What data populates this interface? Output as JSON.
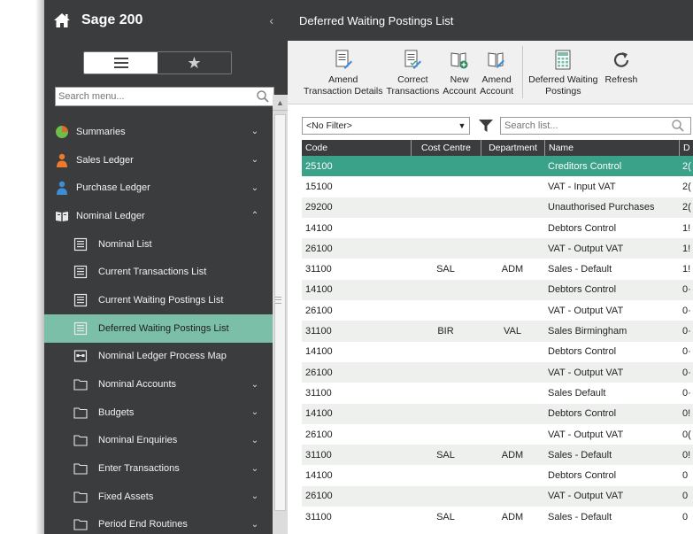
{
  "sidebar": {
    "title": "Sage 200",
    "collapse_glyph": "‹",
    "search_placeholder": "Search menu...",
    "items": [
      {
        "label": "Summaries",
        "icon": "pie-chart-icon",
        "level": 0,
        "chevron": "⌄"
      },
      {
        "label": "Sales Ledger",
        "icon": "sales-person-icon",
        "level": 0,
        "chevron": "⌄"
      },
      {
        "label": "Purchase Ledger",
        "icon": "purchase-person-icon",
        "level": 0,
        "chevron": "⌄"
      },
      {
        "label": "Nominal Ledger",
        "icon": "book-icon",
        "level": 0,
        "chevron": "⌃"
      },
      {
        "label": "Nominal List",
        "icon": "list-icon",
        "level": 1,
        "chevron": ""
      },
      {
        "label": "Current Transactions List",
        "icon": "list-icon",
        "level": 1,
        "chevron": ""
      },
      {
        "label": "Current Waiting Postings List",
        "icon": "list-icon",
        "level": 1,
        "chevron": ""
      },
      {
        "label": "Deferred Waiting Postings List",
        "icon": "list-icon",
        "level": 1,
        "chevron": "",
        "active": true
      },
      {
        "label": "Nominal Ledger Process Map",
        "icon": "process-map-icon",
        "level": 1,
        "chevron": ""
      },
      {
        "label": "Nominal Accounts",
        "icon": "folder-icon",
        "level": 1,
        "chevron": "⌄"
      },
      {
        "label": "Budgets",
        "icon": "folder-icon",
        "level": 1,
        "chevron": "⌄"
      },
      {
        "label": "Nominal Enquiries",
        "icon": "folder-icon",
        "level": 1,
        "chevron": "⌄"
      },
      {
        "label": "Enter Transactions",
        "icon": "folder-icon",
        "level": 1,
        "chevron": "⌄"
      },
      {
        "label": "Fixed Assets",
        "icon": "folder-icon",
        "level": 1,
        "chevron": "⌄"
      },
      {
        "label": "Period End Routines",
        "icon": "folder-icon",
        "level": 1,
        "chevron": "⌄"
      }
    ]
  },
  "main": {
    "title": "Deferred Waiting Postings List",
    "toolbar": [
      {
        "line1": "Amend",
        "line2": "Transaction Details",
        "icon": "amend-transaction-icon"
      },
      {
        "line1": "Correct",
        "line2": "Transactions",
        "icon": "correct-transactions-icon"
      },
      {
        "line1": "New",
        "line2": "Account",
        "icon": "new-account-icon"
      },
      {
        "line1": "Amend",
        "line2": "Account",
        "icon": "amend-account-icon"
      },
      {
        "line1": "Deferred Waiting",
        "line2": "Postings",
        "icon": "deferred-postings-icon"
      },
      {
        "line1": "Refresh",
        "line2": "",
        "icon": "refresh-icon"
      }
    ],
    "filter": {
      "selected": "<No Filter>",
      "search_placeholder": "Search list..."
    },
    "columns": [
      "Code",
      "Cost Centre",
      "Department",
      "Name",
      "D"
    ],
    "rows": [
      {
        "code": "25100",
        "cc": "",
        "dept": "",
        "name": "Creditors Control",
        "d": "2(",
        "selected": true
      },
      {
        "code": "15100",
        "cc": "",
        "dept": "",
        "name": "VAT - Input VAT",
        "d": "2("
      },
      {
        "code": "29200",
        "cc": "",
        "dept": "",
        "name": "Unauthorised Purchases",
        "d": "2("
      },
      {
        "code": "14100",
        "cc": "",
        "dept": "",
        "name": "Debtors Control",
        "d": "1!"
      },
      {
        "code": "26100",
        "cc": "",
        "dept": "",
        "name": "VAT - Output VAT",
        "d": "1!"
      },
      {
        "code": "31100",
        "cc": "SAL",
        "dept": "ADM",
        "name": "Sales - Default",
        "d": "1!"
      },
      {
        "code": "14100",
        "cc": "",
        "dept": "",
        "name": "Debtors Control",
        "d": "0·"
      },
      {
        "code": "26100",
        "cc": "",
        "dept": "",
        "name": "VAT - Output VAT",
        "d": "0·"
      },
      {
        "code": "31100",
        "cc": "BIR",
        "dept": "VAL",
        "name": "Sales Birmingham",
        "d": "0·"
      },
      {
        "code": "14100",
        "cc": "",
        "dept": "",
        "name": "Debtors Control",
        "d": "0·"
      },
      {
        "code": "26100",
        "cc": "",
        "dept": "",
        "name": "VAT - Output VAT",
        "d": "0·"
      },
      {
        "code": "31100",
        "cc": "",
        "dept": "",
        "name": "Sales Default",
        "d": "0·"
      },
      {
        "code": "14100",
        "cc": "",
        "dept": "",
        "name": "Debtors Control",
        "d": "0!"
      },
      {
        "code": "26100",
        "cc": "",
        "dept": "",
        "name": "VAT - Output VAT",
        "d": "0("
      },
      {
        "code": "31100",
        "cc": "SAL",
        "dept": "ADM",
        "name": "Sales - Default",
        "d": "0!"
      },
      {
        "code": "14100",
        "cc": "",
        "dept": "",
        "name": "Debtors Control",
        "d": "0"
      },
      {
        "code": "26100",
        "cc": "",
        "dept": "",
        "name": "VAT - Output VAT",
        "d": "0"
      },
      {
        "code": "31100",
        "cc": "SAL",
        "dept": "ADM",
        "name": "Sales - Default",
        "d": "0"
      }
    ]
  },
  "colors": {
    "sidebar_bg": "#3a3c3e",
    "active_menu": "#7bbfa9",
    "selected_row": "#3aa289",
    "toolbar_bg": "#f0f0f0"
  }
}
